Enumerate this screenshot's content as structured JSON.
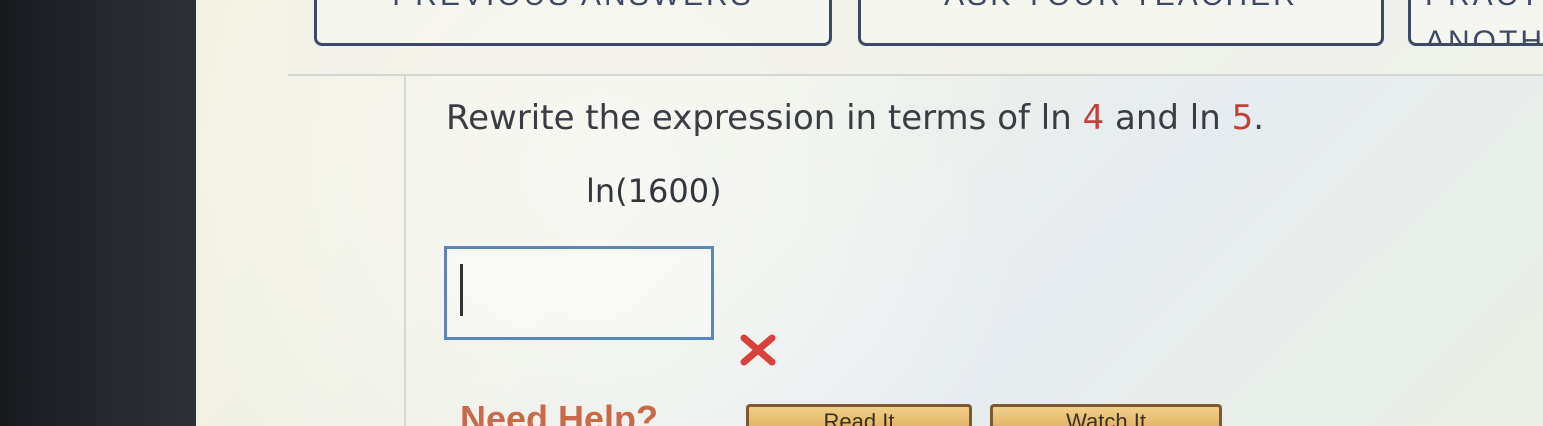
{
  "toolbar": {
    "buttons": [
      {
        "label": "PREVIOUS ANSWERS"
      },
      {
        "label": "ASK YOUR TEACHER"
      },
      {
        "label": "PRACTICE ANOTHER"
      }
    ]
  },
  "question": {
    "prefix": "Rewrite the expression in terms of ln ",
    "num1": "4",
    "middle": " and ln ",
    "num2": "5",
    "suffix": "."
  },
  "expression": "ln(1600)",
  "answer": {
    "value": "",
    "status_icon": "x-mark-icon",
    "status_color": "#d9413b"
  },
  "help": {
    "title": "Need Help?",
    "buttons": [
      {
        "label": "Read It"
      },
      {
        "label": "Watch It"
      }
    ]
  },
  "colors": {
    "button_border": "#3c4a62",
    "input_border": "#5b86b8",
    "highlight_red": "#c2403a"
  }
}
